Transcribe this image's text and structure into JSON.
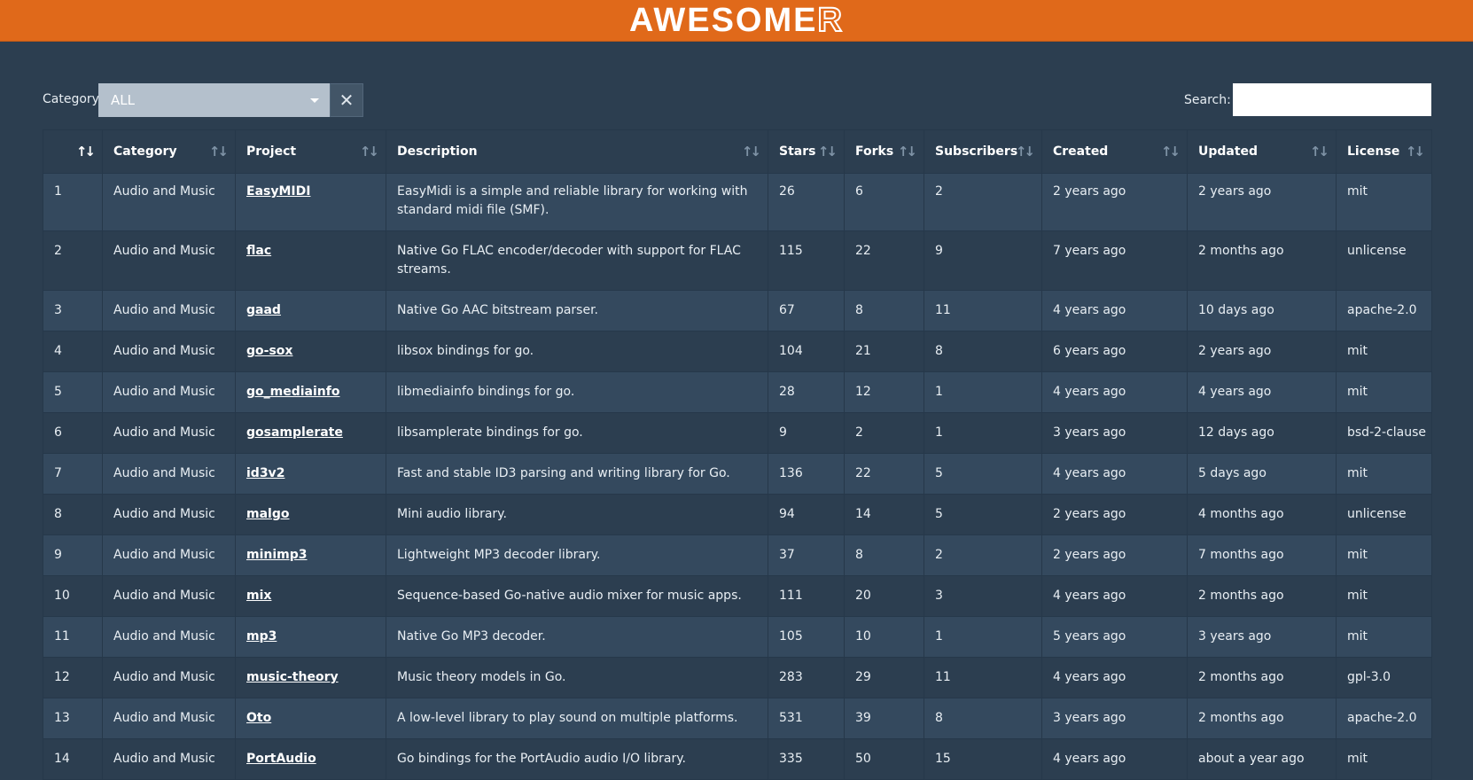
{
  "brand": {
    "text_main": "AWESOME",
    "text_last": "R"
  },
  "filter": {
    "category_label": "Category:",
    "category_value": "ALL",
    "clear_symbol": "✕",
    "search_label": "Search:",
    "search_value": ""
  },
  "table": {
    "columns": [
      "",
      "Category",
      "Project",
      "Description",
      "Stars",
      "Forks",
      "Subscribers",
      "Created",
      "Updated",
      "License"
    ],
    "rows": [
      [
        "1",
        "Audio and Music",
        "EasyMIDI",
        "EasyMidi is a simple and reliable library for working with standard midi file (SMF).",
        "26",
        "6",
        "2",
        "2 years ago",
        "2 years ago",
        "mit"
      ],
      [
        "2",
        "Audio and Music",
        "flac",
        "Native Go FLAC encoder/decoder with support for FLAC streams.",
        "115",
        "22",
        "9",
        "7 years ago",
        "2 months ago",
        "unlicense"
      ],
      [
        "3",
        "Audio and Music",
        "gaad",
        "Native Go AAC bitstream parser.",
        "67",
        "8",
        "11",
        "4 years ago",
        "10 days ago",
        "apache-2.0"
      ],
      [
        "4",
        "Audio and Music",
        "go-sox",
        "libsox bindings for go.",
        "104",
        "21",
        "8",
        "6 years ago",
        "2 years ago",
        "mit"
      ],
      [
        "5",
        "Audio and Music",
        "go_mediainfo",
        "libmediainfo bindings for go.",
        "28",
        "12",
        "1",
        "4 years ago",
        "4 years ago",
        "mit"
      ],
      [
        "6",
        "Audio and Music",
        "gosamplerate",
        "libsamplerate bindings for go.",
        "9",
        "2",
        "1",
        "3 years ago",
        "12 days ago",
        "bsd-2-clause"
      ],
      [
        "7",
        "Audio and Music",
        "id3v2",
        "Fast and stable ID3 parsing and writing library for Go.",
        "136",
        "22",
        "5",
        "4 years ago",
        "5 days ago",
        "mit"
      ],
      [
        "8",
        "Audio and Music",
        "malgo",
        "Mini audio library.",
        "94",
        "14",
        "5",
        "2 years ago",
        "4 months ago",
        "unlicense"
      ],
      [
        "9",
        "Audio and Music",
        "minimp3",
        "Lightweight MP3 decoder library.",
        "37",
        "8",
        "2",
        "2 years ago",
        "7 months ago",
        "mit"
      ],
      [
        "10",
        "Audio and Music",
        "mix",
        "Sequence-based Go-native audio mixer for music apps.",
        "111",
        "20",
        "3",
        "4 years ago",
        "2 months ago",
        "mit"
      ],
      [
        "11",
        "Audio and Music",
        "mp3",
        "Native Go MP3 decoder.",
        "105",
        "10",
        "1",
        "5 years ago",
        "3 years ago",
        "mit"
      ],
      [
        "12",
        "Audio and Music",
        "music-theory",
        "Music theory models in Go.",
        "283",
        "29",
        "11",
        "4 years ago",
        "2 months ago",
        "gpl-3.0"
      ],
      [
        "13",
        "Audio and Music",
        "Oto",
        "A low-level library to play sound on multiple platforms.",
        "531",
        "39",
        "8",
        "3 years ago",
        "2 months ago",
        "apache-2.0"
      ],
      [
        "14",
        "Audio and Music",
        "PortAudio",
        "Go bindings for the PortAudio audio I/O library.",
        "335",
        "50",
        "15",
        "4 years ago",
        "about a year ago",
        "mit"
      ]
    ]
  }
}
